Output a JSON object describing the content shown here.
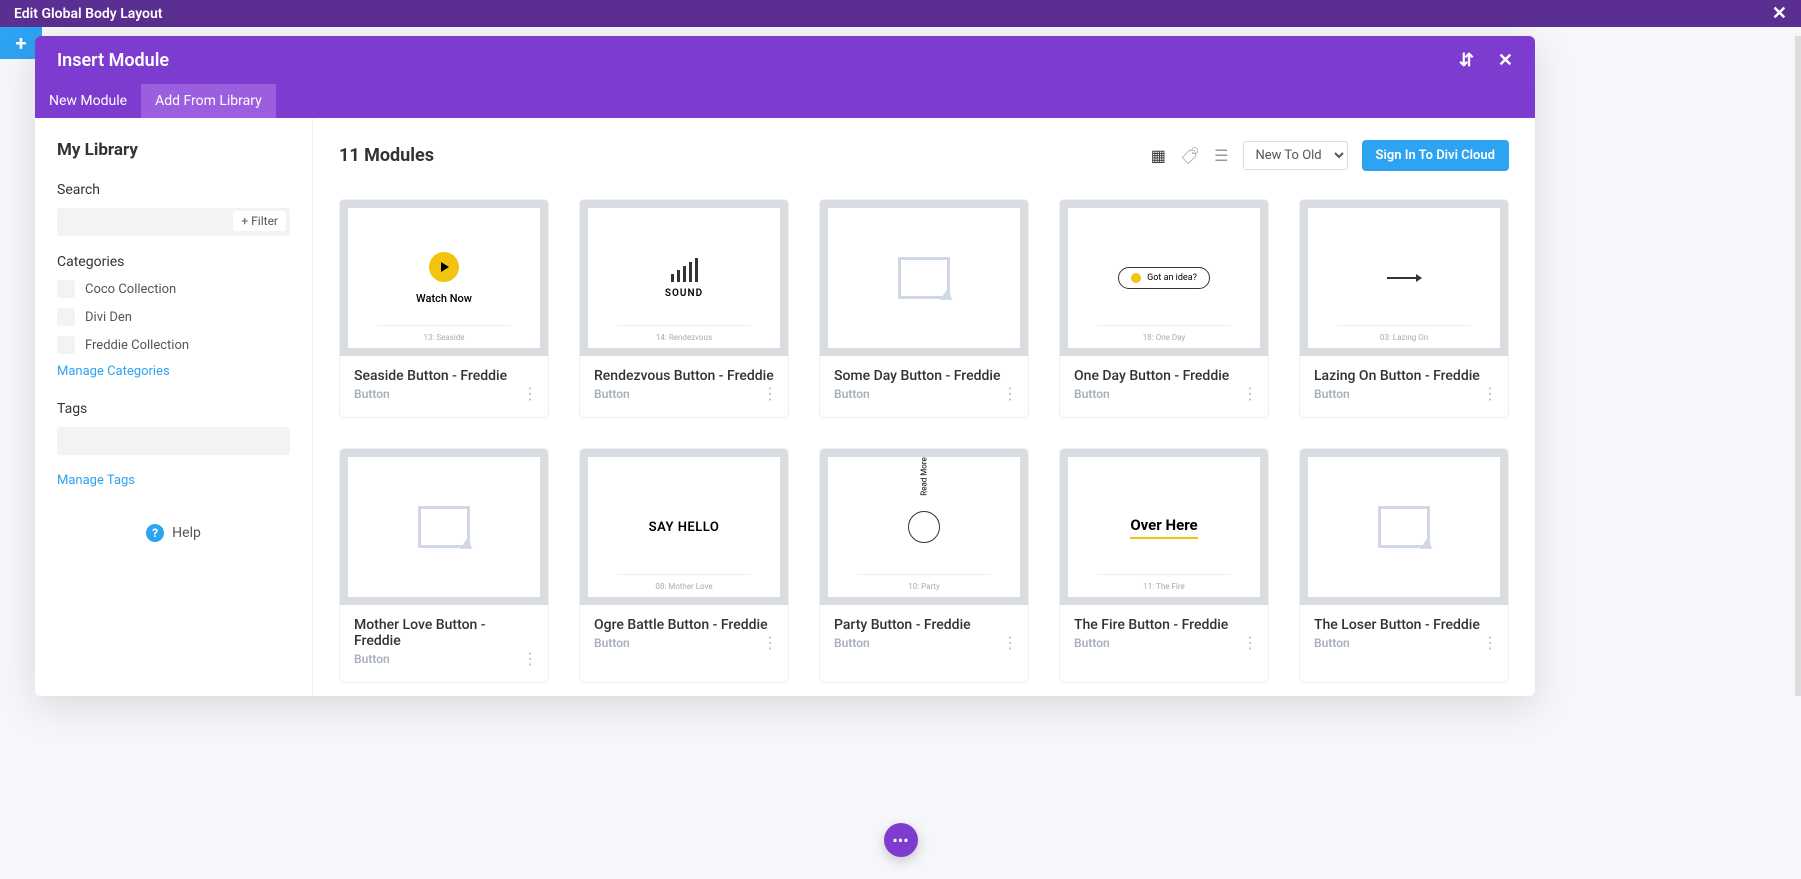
{
  "topbar": {
    "title": "Edit Global Body Layout"
  },
  "modal": {
    "title": "Insert Module",
    "tabs": {
      "new": "New Module",
      "library": "Add From Library"
    }
  },
  "sidebar": {
    "title": "My Library",
    "search_label": "Search",
    "filter_btn": "+ Filter",
    "categories_label": "Categories",
    "categories": [
      "Coco Collection",
      "Divi Den",
      "Freddie Collection"
    ],
    "manage_categories": "Manage Categories",
    "tags_label": "Tags",
    "manage_tags": "Manage Tags",
    "help": "Help"
  },
  "content": {
    "count_label": "11 Modules",
    "sort": "New To Old",
    "signin": "Sign In To Divi Cloud"
  },
  "cards": [
    {
      "title": "Seaside Button - Freddie",
      "type": "Button",
      "caption": "13: Seaside",
      "preview": "seaside",
      "label": "Watch Now"
    },
    {
      "title": "Rendezvous Button - Freddie",
      "type": "Button",
      "caption": "14: Rendezvous",
      "preview": "sound",
      "label": "SOUND"
    },
    {
      "title": "Some Day Button - Freddie",
      "type": "Button",
      "caption": "",
      "preview": "placeholder",
      "label": ""
    },
    {
      "title": "One Day Button - Freddie",
      "type": "Button",
      "caption": "18: One Day",
      "preview": "idea",
      "label": "Got an idea?"
    },
    {
      "title": "Lazing On Button - Freddie",
      "type": "Button",
      "caption": "03: Lazing On",
      "preview": "arrow",
      "label": ""
    },
    {
      "title": "Mother Love Button - Freddie",
      "type": "Button",
      "caption": "",
      "preview": "placeholder",
      "label": ""
    },
    {
      "title": "Ogre Battle Button - Freddie",
      "type": "Button",
      "caption": "08: Mother Love",
      "preview": "sayhello",
      "label": "SAY HELLO"
    },
    {
      "title": "Party Button - Freddie",
      "type": "Button",
      "caption": "10: Party",
      "preview": "readmore",
      "label": "Read More"
    },
    {
      "title": "The Fire Button - Freddie",
      "type": "Button",
      "caption": "11: The Fire",
      "preview": "overhere",
      "label": "Over Here"
    },
    {
      "title": "The Loser Button - Freddie",
      "type": "Button",
      "caption": "",
      "preview": "placeholder",
      "label": ""
    }
  ]
}
